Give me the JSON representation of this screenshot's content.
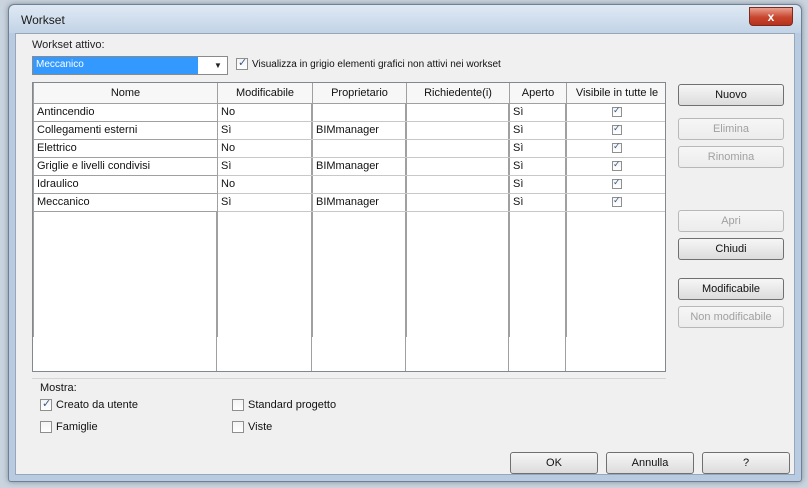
{
  "window": {
    "title": "Workset",
    "close_label": "x"
  },
  "active_workset": {
    "label": "Workset attivo:",
    "value": "Meccanico",
    "dropdown_icon": "triangle-down"
  },
  "gray_checkbox": {
    "label": "Visualizza in grigio elementi grafici non attivi nei workset",
    "checked": true
  },
  "table": {
    "headers": [
      "Nome",
      "Modificabile",
      "Proprietario",
      "Richiedente(i)",
      "Aperto",
      "Visibile in tutte le"
    ],
    "rows": [
      {
        "name": "Antincendio",
        "editable": "No",
        "owner": "",
        "requester": "",
        "open": "Sì",
        "visible": true
      },
      {
        "name": "Collegamenti esterni",
        "editable": "Sì",
        "owner": "BIMmanager",
        "requester": "",
        "open": "Sì",
        "visible": true
      },
      {
        "name": "Elettrico",
        "editable": "No",
        "owner": "",
        "requester": "",
        "open": "Sì",
        "visible": true
      },
      {
        "name": "Griglie e livelli condivisi",
        "editable": "Sì",
        "owner": "BIMmanager",
        "requester": "",
        "open": "Sì",
        "visible": true
      },
      {
        "name": "Idraulico",
        "editable": "No",
        "owner": "",
        "requester": "",
        "open": "Sì",
        "visible": true
      },
      {
        "name": "Meccanico",
        "editable": "Sì",
        "owner": "BIMmanager",
        "requester": "",
        "open": "Sì",
        "visible": true
      }
    ]
  },
  "side_buttons": {
    "new": "Nuovo",
    "delete": "Elimina",
    "rename": "Rinomina",
    "open": "Apri",
    "close": "Chiudi",
    "editable": "Modificabile",
    "not_editable": "Non modificabile"
  },
  "show": {
    "label": "Mostra:",
    "user_created": {
      "label": "Creato da utente",
      "checked": true
    },
    "families": {
      "label": "Famiglie",
      "checked": false
    },
    "project_standards": {
      "label": "Standard progetto",
      "checked": false
    },
    "views": {
      "label": "Viste",
      "checked": false
    }
  },
  "bottom_buttons": {
    "ok": "OK",
    "cancel": "Annulla",
    "help": "?"
  }
}
